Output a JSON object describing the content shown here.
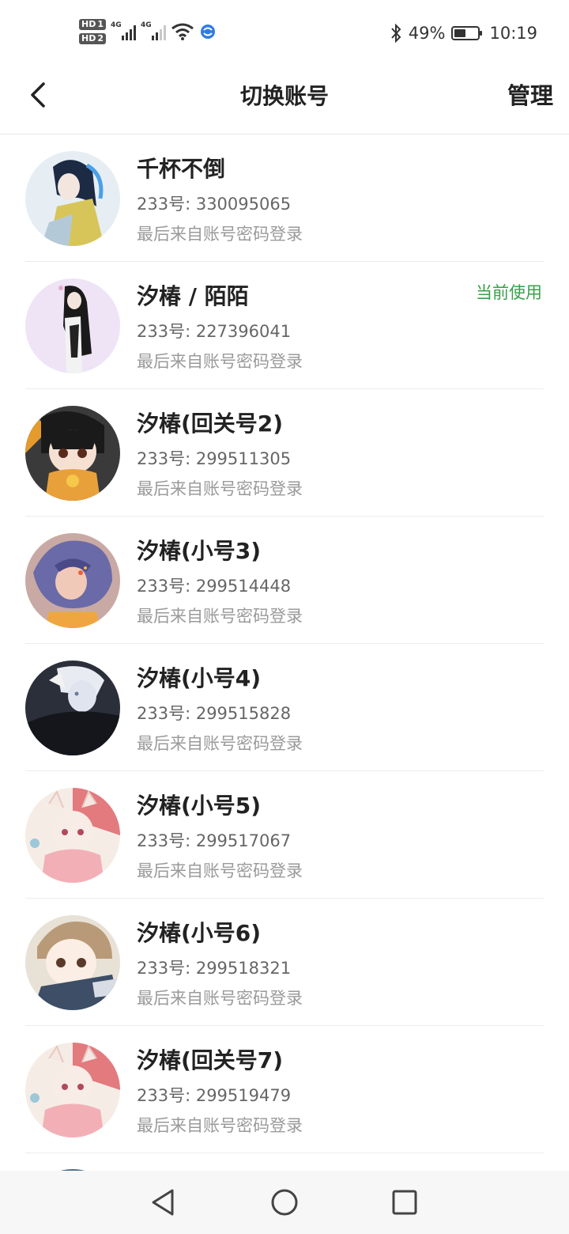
{
  "status_bar": {
    "hd1": "HD",
    "hd1_sim": "1",
    "hd2": "HD",
    "hd2_sim": "2",
    "net1": "4G",
    "net2": "4G",
    "battery_text": "49%",
    "battery_level": 0.49,
    "time": "10:19"
  },
  "nav": {
    "title": "切换账号",
    "manage_label": "管理"
  },
  "accounts": [
    {
      "name": "千杯不倒",
      "uid": "233号: 330095065",
      "login": "最后来自账号密码登录",
      "current": ""
    },
    {
      "name": "汐椿 / 陌陌",
      "uid": "233号: 227396041",
      "login": "最后来自账号密码登录",
      "current": "当前使用"
    },
    {
      "name": "汐椿(回关号2)",
      "uid": "233号: 299511305",
      "login": "最后来自账号密码登录",
      "current": ""
    },
    {
      "name": "汐椿(小号3)",
      "uid": "233号: 299514448",
      "login": "最后来自账号密码登录",
      "current": ""
    },
    {
      "name": "汐椿(小号4)",
      "uid": "233号: 299515828",
      "login": "最后来自账号密码登录",
      "current": ""
    },
    {
      "name": "汐椿(小号5)",
      "uid": "233号: 299517067",
      "login": "最后来自账号密码登录",
      "current": ""
    },
    {
      "name": "汐椿(小号6)",
      "uid": "233号: 299518321",
      "login": "最后来自账号密码登录",
      "current": ""
    },
    {
      "name": "汐椿(回关号7)",
      "uid": "233号: 299519479",
      "login": "最后来自账号密码登录",
      "current": ""
    }
  ],
  "colors": {
    "accent_current": "#3aa04a",
    "text_primary": "#222222",
    "text_secondary": "#666666",
    "text_muted": "#9a9a9a"
  }
}
